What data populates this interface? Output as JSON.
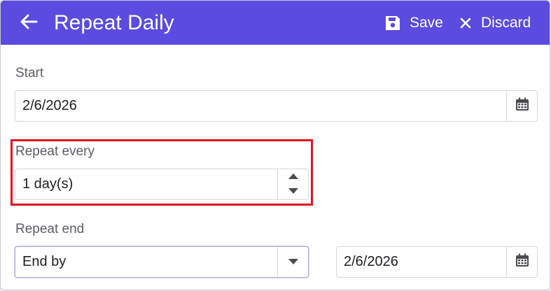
{
  "header": {
    "title": "Repeat Daily",
    "save_label": "Save",
    "discard_label": "Discard"
  },
  "start": {
    "label": "Start",
    "date": "2/6/2026"
  },
  "repeat_every": {
    "label": "Repeat every",
    "value": "1 day(s)"
  },
  "repeat_end": {
    "label": "Repeat end",
    "option": "End by",
    "date": "2/6/2026"
  },
  "colors": {
    "titlebar": "#5b4bdf",
    "highlight": "#e0141e"
  }
}
